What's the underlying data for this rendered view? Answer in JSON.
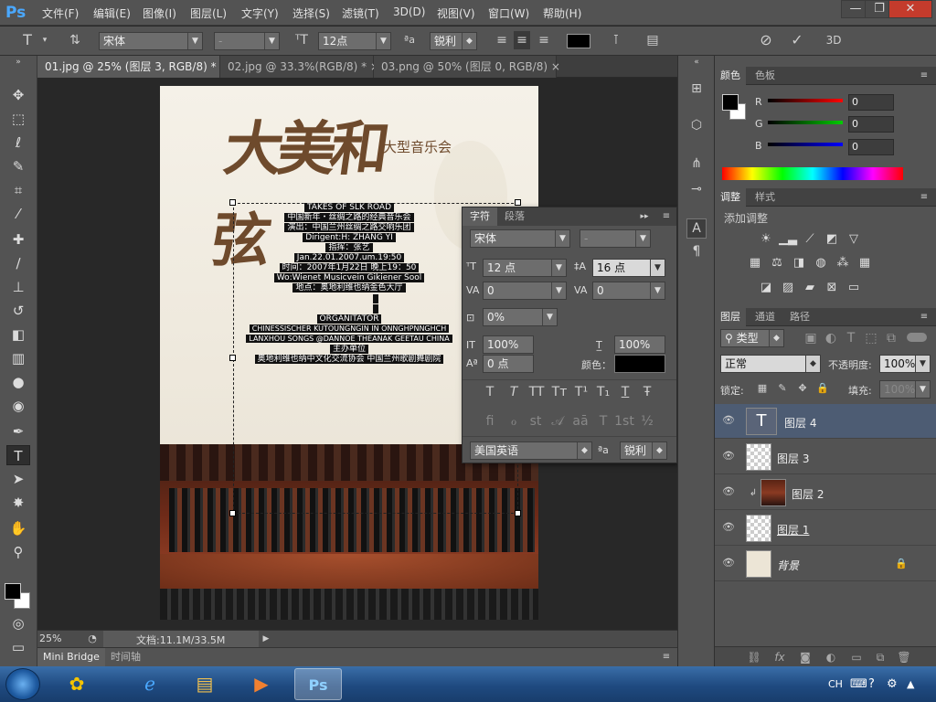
{
  "app": {
    "logo": "Ps"
  },
  "menu": [
    "文件(F)",
    "编辑(E)",
    "图像(I)",
    "图层(L)",
    "文字(Y)",
    "选择(S)",
    "滤镜(T)",
    "3D(D)",
    "视图(V)",
    "窗口(W)",
    "帮助(H)"
  ],
  "window_controls": {
    "minimize": "—",
    "restore": "❐",
    "close": "✕"
  },
  "options": {
    "font_family": "宋体",
    "font_style": "-",
    "font_size": "12点",
    "aa_method": "锐利",
    "text_color": "#000000",
    "mode_3d": "3D"
  },
  "tabs": [
    "01.jpg @ 25% (图层 3, RGB/8) *",
    "02.jpg @ 33.3%(RGB/8) *",
    "03.png @ 50% (图层 0, RGB/8)"
  ],
  "tab_close": "×",
  "document": {
    "title_calligraphy": "大美和弦",
    "subtitle": "大型音乐会",
    "credits": [
      "TAKES OF SLK ROAD",
      "中国新年・丝绸之路的经典音乐会",
      "演出：中国兰州丝绸之路交响乐团",
      "Dirigent:H: ZHANG YI",
      "指挥：张艺",
      "Jan.22.01.2007.um.19:50",
      "时间：2007年1月22日 晚上19：50",
      "Wo:Wienet Musicvein Gikiener Sool",
      "地点：奥地利维也纳金色大厅",
      "",
      "",
      "ORGANITATOR",
      "CHINESSISCHER KUTOUNGNGIN IN ONNGHPNNGHCH",
      "LANXHOU SONGS @DANNOE THEANAK GEETAU CHINA",
      "主办单位",
      "奥地利维也纳中文化交流协会  中国兰州歌剧舞剧院"
    ]
  },
  "status": {
    "zoom": "25%",
    "doc_label": "文档:11.1M/33.5M"
  },
  "bottom_tabs": [
    "Mini Bridge",
    "时间轴"
  ],
  "char_panel": {
    "tabs": [
      "字符",
      "段落"
    ],
    "font": "宋体",
    "style": "-",
    "size": "12 点",
    "leading": "16 点",
    "kerning": "0",
    "tracking": "0",
    "scale_pct": "0%",
    "vscale": "100%",
    "hscale": "100%",
    "baseline": "0 点",
    "color_label": "颜色：",
    "style_buttons": [
      "T",
      "T",
      "TT",
      "Tт",
      "T¹",
      "T₁",
      "T",
      "Ŧ"
    ],
    "opentype_buttons": [
      "fi",
      "ℴ",
      "st",
      "𝒜",
      "aā",
      "T",
      "1st",
      "½"
    ],
    "language": "美国英语",
    "aa": "锐利",
    "aa_icon": "ªa"
  },
  "color_panel": {
    "tabs": [
      "颜色",
      "色板"
    ],
    "channels": [
      {
        "label": "R",
        "value": "0"
      },
      {
        "label": "G",
        "value": "0"
      },
      {
        "label": "B",
        "value": "0"
      }
    ]
  },
  "adjust_panel": {
    "tabs": [
      "调整",
      "样式"
    ],
    "title": "添加调整"
  },
  "layers_panel": {
    "tabs": [
      "图层",
      "通道",
      "路径"
    ],
    "filter": "类型",
    "blend": "正常",
    "opacity_label": "不透明度:",
    "opacity": "100%",
    "lock_label": "锁定:",
    "fill_label": "填充:",
    "fill": "100%",
    "layers": [
      {
        "name": "图层 4",
        "kind": "text"
      },
      {
        "name": "图层 3",
        "kind": "empty"
      },
      {
        "name": "图层 2",
        "kind": "photo"
      },
      {
        "name": "图层 1",
        "kind": "empty"
      },
      {
        "name": "背景",
        "kind": "background"
      }
    ]
  },
  "tray": {
    "lang": "CH"
  }
}
